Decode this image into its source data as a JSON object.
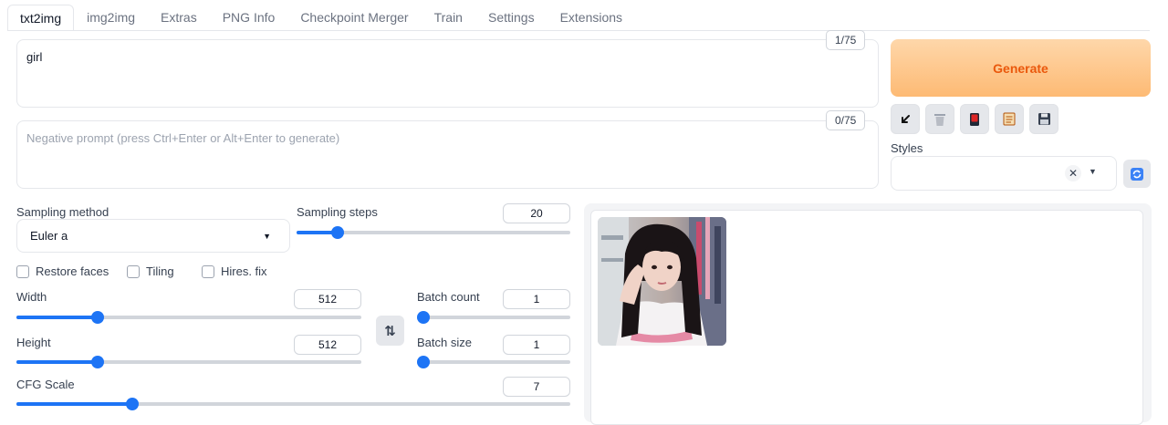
{
  "tabs": [
    {
      "label": "txt2img",
      "active": true
    },
    {
      "label": "img2img"
    },
    {
      "label": "Extras"
    },
    {
      "label": "PNG Info"
    },
    {
      "label": "Checkpoint Merger"
    },
    {
      "label": "Train"
    },
    {
      "label": "Settings"
    },
    {
      "label": "Extensions"
    }
  ],
  "prompt": {
    "value": "girl",
    "token_count": "1/75"
  },
  "negative_prompt": {
    "value": "",
    "placeholder": "Negative prompt (press Ctrl+Enter or Alt+Enter to generate)",
    "token_count": "0/75"
  },
  "generate": {
    "label": "Generate",
    "color": "#ea580c"
  },
  "tool_buttons": [
    {
      "icon": "arrow-down-left-icon"
    },
    {
      "icon": "trash-icon"
    },
    {
      "icon": "red-card-icon"
    },
    {
      "icon": "clipboard-icon"
    },
    {
      "icon": "floppy-disk-icon"
    }
  ],
  "styles": {
    "label": "Styles",
    "value": ""
  },
  "sampling_method": {
    "label": "Sampling method",
    "value": "Euler a"
  },
  "sampling_steps": {
    "label": "Sampling steps",
    "value": "20",
    "fraction": 0.15
  },
  "checkboxes": [
    {
      "label": "Restore faces",
      "checked": false
    },
    {
      "label": "Tiling",
      "checked": false
    },
    {
      "label": "Hires. fix",
      "checked": false
    }
  ],
  "width": {
    "label": "Width",
    "value": "512",
    "fraction": 0.235
  },
  "height": {
    "label": "Height",
    "value": "512",
    "fraction": 0.235
  },
  "batch_count": {
    "label": "Batch count",
    "value": "1",
    "fraction": 0.0
  },
  "batch_size": {
    "label": "Batch size",
    "value": "1",
    "fraction": 0.0
  },
  "cfg_scale": {
    "label": "CFG Scale",
    "value": "7",
    "fraction": 0.21
  },
  "accent_color": "#1d74f5"
}
